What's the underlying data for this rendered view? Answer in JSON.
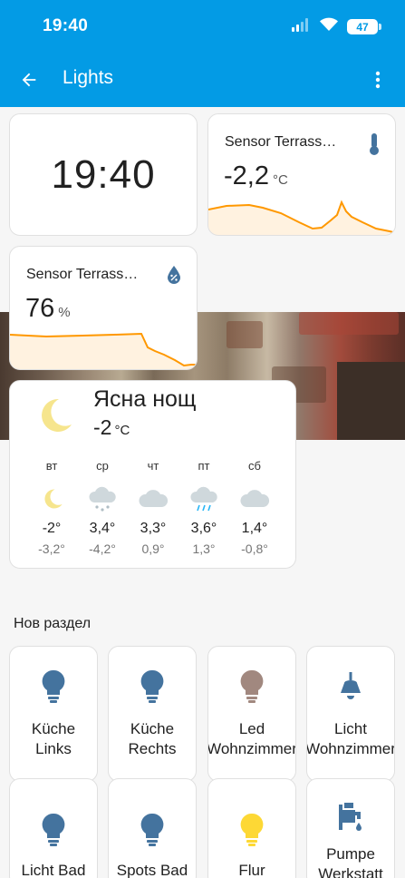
{
  "status_bar": {
    "time": "19:40",
    "battery": "47"
  },
  "app_bar": {
    "title": "Lights"
  },
  "colors": {
    "primary": "#039be5",
    "light_off": "#44739e",
    "light_on": "#fdd835",
    "light_warm": "#a1887f",
    "graph": "#ff9800"
  },
  "clock": {
    "time": "19:40"
  },
  "sensor_temp": {
    "name": "Sensor Terrass…",
    "value": "-2,2",
    "unit": "°C",
    "icon": "thermometer-icon"
  },
  "sensor_humidity": {
    "name": "Sensor Terrass…",
    "value": "76",
    "unit": "%",
    "icon": "water-percent-icon"
  },
  "weather": {
    "state": "Ясна нощ",
    "temperature": "-2",
    "unit": "°C",
    "forecast": [
      {
        "day": "вт",
        "icon": "moon-icon",
        "high": "-2°",
        "low": "-3,2°"
      },
      {
        "day": "ср",
        "icon": "snow-cloud-icon",
        "high": "3,4°",
        "low": "-4,2°"
      },
      {
        "day": "чт",
        "icon": "cloud-icon",
        "high": "3,3°",
        "low": "0,9°"
      },
      {
        "day": "пт",
        "icon": "rain-cloud-icon",
        "high": "3,6°",
        "low": "1,3°"
      },
      {
        "day": "сб",
        "icon": "cloud-icon",
        "high": "1,4°",
        "low": "-0,8°"
      }
    ]
  },
  "section": {
    "title": "Нов раздел"
  },
  "tiles": [
    {
      "label": "Küche\nLinks",
      "icon": "lightbulb-icon",
      "state": "off"
    },
    {
      "label": "Küche\nRechts",
      "icon": "lightbulb-icon",
      "state": "off"
    },
    {
      "label": "Led\nWohnzimmer",
      "icon": "lightbulb-icon",
      "state": "warm"
    },
    {
      "label": "Licht\nWohnzimmer",
      "icon": "ceiling-light-icon",
      "state": "off"
    },
    {
      "label": "Licht Bad",
      "icon": "lightbulb-icon",
      "state": "off"
    },
    {
      "label": "Spots Bad",
      "icon": "lightbulb-icon",
      "state": "off"
    },
    {
      "label": "Flur",
      "icon": "lightbulb-icon",
      "state": "on"
    },
    {
      "label": "Pumpe\nWerkstatt",
      "icon": "water-pump-icon",
      "state": "off"
    }
  ]
}
